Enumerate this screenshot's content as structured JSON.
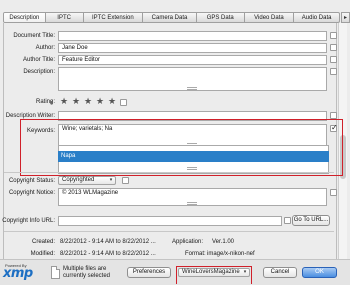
{
  "tabs": [
    "Description",
    "IPTC",
    "IPTC Extension",
    "Camera Data",
    "GPS Data",
    "Video Data",
    "Audio Data"
  ],
  "active_tab": "Description",
  "form": {
    "document_title": {
      "label": "Document Title:",
      "value": ""
    },
    "author": {
      "label": "Author:",
      "value": "Jane Doe"
    },
    "author_title": {
      "label": "Author Title:",
      "value": "Feature Editor"
    },
    "description": {
      "label": "Description:",
      "value": ""
    },
    "rating": {
      "label": "Rating:",
      "value": 0,
      "max": 5
    },
    "description_writer": {
      "label": "Description Writer:",
      "value": ""
    },
    "keywords": {
      "label": "Keywords:",
      "value": "Wine; varietals; Na"
    },
    "keyword_suggestion": "Napa"
  },
  "copyright": {
    "status": {
      "label": "Copyright Status:",
      "value": "Copyrighted"
    },
    "notice": {
      "label": "Copyright Notice:",
      "value": "© 2013  WLMagazine"
    },
    "info_url": {
      "label": "Copyright Info URL:",
      "value": "",
      "button": "Go To URL..."
    }
  },
  "meta": {
    "created_label": "Created:",
    "created_value": "8/22/2012 - 9:14 AM to 8/22/2012 ...",
    "application_label": "Application:",
    "application_value": "Ver.1.00",
    "modified_label": "Modified:",
    "modified_value": "8/22/2012 - 9:14 AM to 8/22/2012 ...",
    "format_label": "Format:",
    "format_value": "image/x-nikon-nef"
  },
  "footer": {
    "powered_by": "Powered By",
    "logo": "xmp",
    "multi_files_line1": "Multiple files are",
    "multi_files_line2": "currently selected",
    "preferences": "Preferences",
    "template": "WineLoversMagazine",
    "cancel": "Cancel",
    "ok": "OK"
  },
  "colors": {
    "accent": "#2a7fc8",
    "highlight_box": "#d0202a",
    "logo": "#1d6fc3"
  }
}
